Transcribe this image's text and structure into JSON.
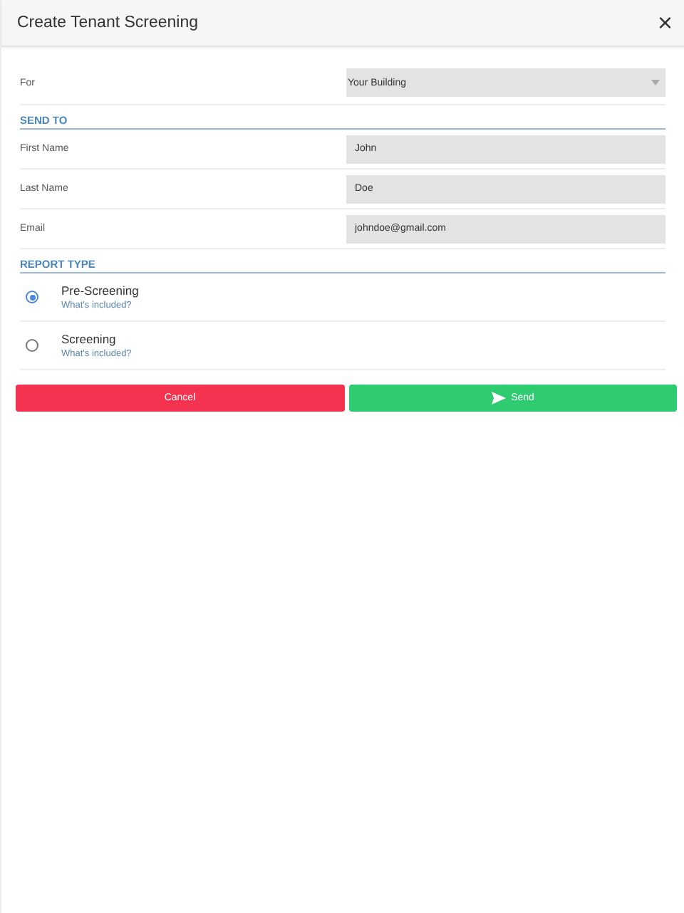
{
  "window": {
    "title": "Create Tenant Screening",
    "close": "×"
  },
  "for": {
    "label": "For",
    "value": "Your Building"
  },
  "send_to": {
    "heading": "SEND TO",
    "fields": [
      {
        "label": "First Name",
        "value": "John"
      },
      {
        "label": "Last Name",
        "value": "Doe"
      },
      {
        "label": "Email",
        "value": "johndoe@gmail.com"
      }
    ]
  },
  "report_type": {
    "heading": "REPORT TYPE",
    "options": [
      {
        "label": "Pre-Screening",
        "link": "What's included?",
        "selected": true
      },
      {
        "label": "Screening",
        "link": "What's included?",
        "selected": false
      }
    ]
  },
  "buttons": [
    {
      "label": "Cancel",
      "kind": "cancel"
    },
    {
      "label": "Send",
      "kind": "send"
    }
  ]
}
